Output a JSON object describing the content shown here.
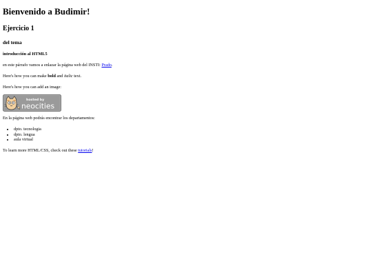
{
  "page": {
    "title": "Bienvenido a Budimir!",
    "h2": "Ejercicio 1",
    "h3": "del tema",
    "h4": "introducción al HTML5",
    "intro": {
      "prefix": "en este párrafo vamos a enlazar la página web del INSTI: ",
      "link_text": "Prado",
      "suffix": "."
    },
    "formatting": {
      "prefix": "Here's how you can make ",
      "bold": "bold",
      "middle": " and ",
      "italic": "italic",
      "suffix": " text."
    },
    "image_intro": "Here's how you can add an image:",
    "badge": {
      "top_text": "hosted by",
      "main_text": "neocities"
    },
    "departments_intro": "En la página web podrás encontrar los departamentos:",
    "departments": [
      "dpto. tecnologia",
      "dpto. lengua",
      "aula virtual"
    ],
    "learn_more": {
      "prefix": "To learn more HTML/CSS, check out these ",
      "link_text": "tutorials",
      "suffix": "!"
    }
  },
  "colors": {
    "link": "#0000ee",
    "badge_bg": "#9a9a9a",
    "badge_border": "#777777",
    "badge_text": "#ffffff"
  }
}
